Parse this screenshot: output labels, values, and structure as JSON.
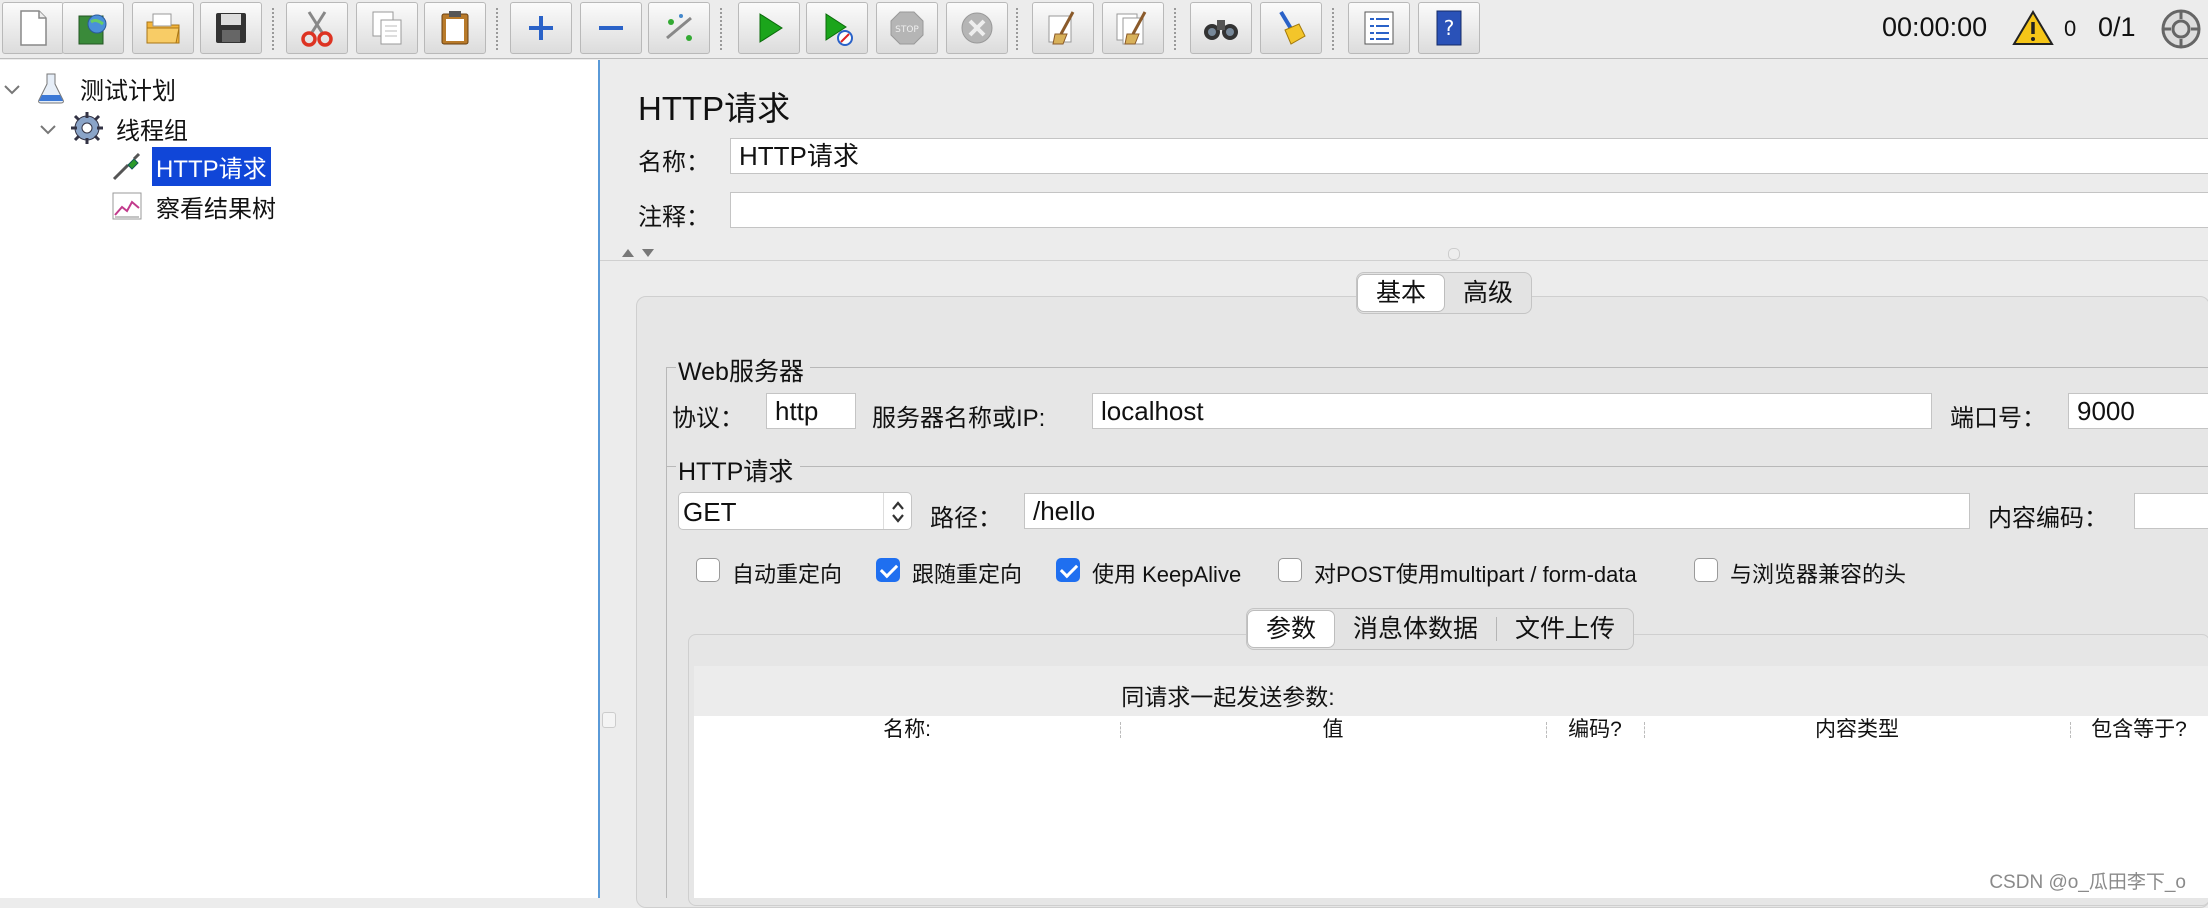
{
  "toolbar": {
    "buttons": [
      {
        "name": "new",
        "icon": "new-document-icon"
      },
      {
        "name": "templates",
        "icon": "templates-icon"
      },
      {
        "name": "open",
        "icon": "open-folder-icon"
      },
      {
        "name": "save",
        "icon": "save-floppy-icon"
      },
      {
        "name": "cut",
        "icon": "scissors-icon"
      },
      {
        "name": "copy",
        "icon": "copy-icon"
      },
      {
        "name": "paste",
        "icon": "paste-clipboard-icon"
      },
      {
        "name": "expand",
        "icon": "plus-icon"
      },
      {
        "name": "collapse",
        "icon": "minus-icon"
      },
      {
        "name": "toggle",
        "icon": "toggle-wand-icon"
      },
      {
        "name": "start",
        "icon": "play-icon"
      },
      {
        "name": "start-no-pauses",
        "icon": "play-no-timers-icon"
      },
      {
        "name": "stop",
        "icon": "stop-icon"
      },
      {
        "name": "shutdown",
        "icon": "shutdown-icon"
      },
      {
        "name": "clear",
        "icon": "broom-clear-icon"
      },
      {
        "name": "clear-all",
        "icon": "broom-clear-all-icon"
      },
      {
        "name": "search",
        "icon": "binoculars-icon"
      },
      {
        "name": "reset-search",
        "icon": "broom-reset-icon"
      },
      {
        "name": "function-helper",
        "icon": "list-icon"
      },
      {
        "name": "help",
        "icon": "help-book-icon"
      }
    ],
    "elapsed": "00:00:00",
    "warning_count": "0",
    "threads": "0/1"
  },
  "tree": {
    "items": [
      {
        "label": "测试计划",
        "icon": "test-plan-flask-icon"
      },
      {
        "label": "线程组",
        "icon": "thread-group-gear-icon"
      },
      {
        "label": "HTTP请求",
        "icon": "sampler-pipette-icon",
        "selected": true
      },
      {
        "label": "察看结果树",
        "icon": "result-tree-chart-icon"
      }
    ]
  },
  "panel": {
    "title": "HTTP请求",
    "name_label": "名称：",
    "name_value": "HTTP请求",
    "comment_label": "注释：",
    "comment_value": "",
    "tabs": [
      "基本",
      "高级"
    ],
    "web_server": {
      "legend": "Web服务器",
      "protocol_label": "协议：",
      "protocol_value": "http",
      "server_label": "服务器名称或IP:",
      "server_value": "localhost",
      "port_label": "端口号：",
      "port_value": "9000"
    },
    "http_request": {
      "legend": "HTTP请求",
      "method": "GET",
      "path_label": "路径：",
      "path_value": "/hello",
      "encoding_label": "内容编码：",
      "encoding_value": ""
    },
    "checkboxes": [
      {
        "label": "自动重定向",
        "checked": false
      },
      {
        "label": "跟随重定向",
        "checked": true
      },
      {
        "label": "使用 KeepAlive",
        "checked": true
      },
      {
        "label": "对POST使用multipart / form-data",
        "checked": false
      },
      {
        "label": "与浏览器兼容的头",
        "checked": false
      }
    ],
    "sub_tabs": [
      "参数",
      "消息体数据",
      "文件上传"
    ],
    "params_title": "同请求一起发送参数:",
    "columns": [
      "名称:",
      "值",
      "编码?",
      "内容类型",
      "包含等于?"
    ]
  },
  "watermark": "CSDN @o_瓜田李下_o",
  "colors": {
    "selection": "#1046d8",
    "tree_border": "#5a9ad8",
    "checkbox_on": "#1f6ff0"
  }
}
